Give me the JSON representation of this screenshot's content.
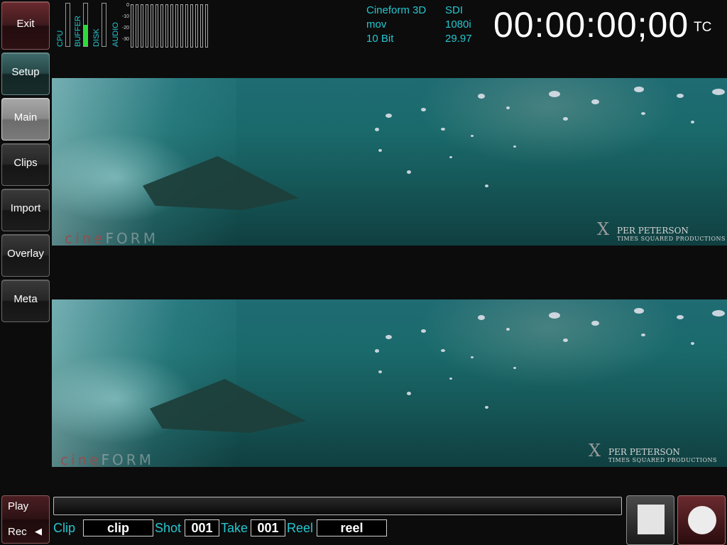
{
  "sidebar": {
    "exit": "Exit",
    "setup": "Setup",
    "main": "Main",
    "clips": "Clips",
    "import": "Import",
    "overlay": "Overlay",
    "meta": "Meta"
  },
  "meters": {
    "cpu_label": "CPU",
    "buffer_label": "BUFFER",
    "disk_label": "DISK",
    "audio_label": "AUDIO",
    "buffer_level": 0.5,
    "db_scale": [
      "0",
      "-10",
      "-20",
      "-30"
    ]
  },
  "format": {
    "codec": "Cineform 3D",
    "container": "mov",
    "bit_depth": "10 Bit",
    "interface": "SDI",
    "resolution": "1080i",
    "frame_rate": "29.97"
  },
  "timecode": {
    "value": "00:00:00;00",
    "label": "TC"
  },
  "video": {
    "watermark_left_a": "cine",
    "watermark_left_b": "FORM",
    "credit_name": "PER PETERSON",
    "credit_company": "TIMES SQUARED PRODUCTIONS",
    "credit_mark": "X"
  },
  "transport": {
    "play": "Play",
    "rec": "Rec",
    "rec_arrow": "◀"
  },
  "metadata": {
    "clip_label": "Clip",
    "clip_value": "clip",
    "shot_label": "Shot",
    "shot_value": "001",
    "take_label": "Take",
    "take_value": "001",
    "reel_label": "Reel",
    "reel_value": "reel"
  },
  "colors": {
    "accent": "#26c6cf",
    "meter_fill": "#2fd83c",
    "exit_red": "#6a2a2e",
    "setup_teal": "#3f6a6a"
  }
}
